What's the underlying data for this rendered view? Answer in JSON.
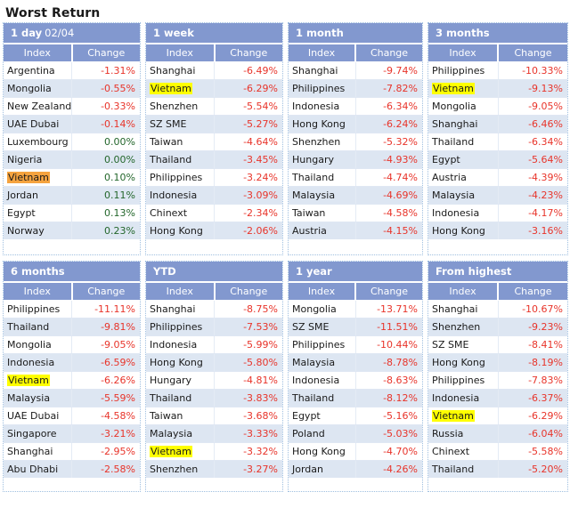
{
  "page": {
    "title": "Worst Return"
  },
  "colors": {
    "header_bg": "#8298cf",
    "negative": "#e8342a",
    "positive": "#23662b",
    "row_alt": "#dde6f2",
    "highlight_yellow": "#ffff00",
    "highlight_orange": "#f5a33f"
  },
  "columns": {
    "index": "Index",
    "change": "Change"
  },
  "tables": [
    {
      "title": "1 day",
      "subtitle": "02/04",
      "rows": [
        {
          "index": "Argentina",
          "change": "-1.31%",
          "sign": "neg",
          "highlight": "none"
        },
        {
          "index": "Mongolia",
          "change": "-0.55%",
          "sign": "neg",
          "highlight": "none"
        },
        {
          "index": "New Zealand",
          "change": "-0.33%",
          "sign": "neg",
          "highlight": "none"
        },
        {
          "index": "UAE Dubai",
          "change": "-0.14%",
          "sign": "neg",
          "highlight": "none"
        },
        {
          "index": "Luxembourg",
          "change": "0.00%",
          "sign": "pos",
          "highlight": "none"
        },
        {
          "index": "Nigeria",
          "change": "0.00%",
          "sign": "pos",
          "highlight": "none"
        },
        {
          "index": "Vietnam",
          "change": "0.10%",
          "sign": "pos",
          "highlight": "orange"
        },
        {
          "index": "Jordan",
          "change": "0.11%",
          "sign": "pos",
          "highlight": "none"
        },
        {
          "index": "Egypt",
          "change": "0.13%",
          "sign": "pos",
          "highlight": "none"
        },
        {
          "index": "Norway",
          "change": "0.23%",
          "sign": "pos",
          "highlight": "none"
        }
      ]
    },
    {
      "title": "1 week",
      "subtitle": "",
      "rows": [
        {
          "index": "Shanghai",
          "change": "-6.49%",
          "sign": "neg",
          "highlight": "none"
        },
        {
          "index": "Vietnam",
          "change": "-6.29%",
          "sign": "neg",
          "highlight": "yellow"
        },
        {
          "index": "Shenzhen",
          "change": "-5.54%",
          "sign": "neg",
          "highlight": "none"
        },
        {
          "index": "SZ SME",
          "change": "-5.27%",
          "sign": "neg",
          "highlight": "none"
        },
        {
          "index": "Taiwan",
          "change": "-4.64%",
          "sign": "neg",
          "highlight": "none"
        },
        {
          "index": "Thailand",
          "change": "-3.45%",
          "sign": "neg",
          "highlight": "none"
        },
        {
          "index": "Philippines",
          "change": "-3.24%",
          "sign": "neg",
          "highlight": "none"
        },
        {
          "index": "Indonesia",
          "change": "-3.09%",
          "sign": "neg",
          "highlight": "none"
        },
        {
          "index": "Chinext",
          "change": "-2.34%",
          "sign": "neg",
          "highlight": "none"
        },
        {
          "index": "Hong Kong",
          "change": "-2.06%",
          "sign": "neg",
          "highlight": "none"
        }
      ]
    },
    {
      "title": "1 month",
      "subtitle": "",
      "rows": [
        {
          "index": "Shanghai",
          "change": "-9.74%",
          "sign": "neg",
          "highlight": "none"
        },
        {
          "index": "Philippines",
          "change": "-7.82%",
          "sign": "neg",
          "highlight": "none"
        },
        {
          "index": "Indonesia",
          "change": "-6.34%",
          "sign": "neg",
          "highlight": "none"
        },
        {
          "index": "Hong Kong",
          "change": "-6.24%",
          "sign": "neg",
          "highlight": "none"
        },
        {
          "index": "Shenzhen",
          "change": "-5.32%",
          "sign": "neg",
          "highlight": "none"
        },
        {
          "index": "Hungary",
          "change": "-4.93%",
          "sign": "neg",
          "highlight": "none"
        },
        {
          "index": "Thailand",
          "change": "-4.74%",
          "sign": "neg",
          "highlight": "none"
        },
        {
          "index": "Malaysia",
          "change": "-4.69%",
          "sign": "neg",
          "highlight": "none"
        },
        {
          "index": "Taiwan",
          "change": "-4.58%",
          "sign": "neg",
          "highlight": "none"
        },
        {
          "index": "Austria",
          "change": "-4.15%",
          "sign": "neg",
          "highlight": "none"
        }
      ]
    },
    {
      "title": "3 months",
      "subtitle": "",
      "rows": [
        {
          "index": "Philippines",
          "change": "-10.33%",
          "sign": "neg",
          "highlight": "none"
        },
        {
          "index": "Vietnam",
          "change": "-9.13%",
          "sign": "neg",
          "highlight": "yellow"
        },
        {
          "index": "Mongolia",
          "change": "-9.05%",
          "sign": "neg",
          "highlight": "none"
        },
        {
          "index": "Shanghai",
          "change": "-6.46%",
          "sign": "neg",
          "highlight": "none"
        },
        {
          "index": "Thailand",
          "change": "-6.34%",
          "sign": "neg",
          "highlight": "none"
        },
        {
          "index": "Egypt",
          "change": "-5.64%",
          "sign": "neg",
          "highlight": "none"
        },
        {
          "index": "Austria",
          "change": "-4.39%",
          "sign": "neg",
          "highlight": "none"
        },
        {
          "index": "Malaysia",
          "change": "-4.23%",
          "sign": "neg",
          "highlight": "none"
        },
        {
          "index": "Indonesia",
          "change": "-4.17%",
          "sign": "neg",
          "highlight": "none"
        },
        {
          "index": "Hong Kong",
          "change": "-3.16%",
          "sign": "neg",
          "highlight": "none"
        }
      ]
    },
    {
      "title": "6 months",
      "subtitle": "",
      "rows": [
        {
          "index": "Philippines",
          "change": "-11.11%",
          "sign": "neg",
          "highlight": "none"
        },
        {
          "index": "Thailand",
          "change": "-9.81%",
          "sign": "neg",
          "highlight": "none"
        },
        {
          "index": "Mongolia",
          "change": "-9.05%",
          "sign": "neg",
          "highlight": "none"
        },
        {
          "index": "Indonesia",
          "change": "-6.59%",
          "sign": "neg",
          "highlight": "none"
        },
        {
          "index": "Vietnam",
          "change": "-6.26%",
          "sign": "neg",
          "highlight": "yellow"
        },
        {
          "index": "Malaysia",
          "change": "-5.59%",
          "sign": "neg",
          "highlight": "none"
        },
        {
          "index": "UAE Dubai",
          "change": "-4.58%",
          "sign": "neg",
          "highlight": "none"
        },
        {
          "index": "Singapore",
          "change": "-3.21%",
          "sign": "neg",
          "highlight": "none"
        },
        {
          "index": "Shanghai",
          "change": "-2.95%",
          "sign": "neg",
          "highlight": "none"
        },
        {
          "index": "Abu Dhabi",
          "change": "-2.58%",
          "sign": "neg",
          "highlight": "none"
        }
      ]
    },
    {
      "title": "YTD",
      "subtitle": "",
      "rows": [
        {
          "index": "Shanghai",
          "change": "-8.75%",
          "sign": "neg",
          "highlight": "none"
        },
        {
          "index": "Philippines",
          "change": "-7.53%",
          "sign": "neg",
          "highlight": "none"
        },
        {
          "index": "Indonesia",
          "change": "-5.99%",
          "sign": "neg",
          "highlight": "none"
        },
        {
          "index": "Hong Kong",
          "change": "-5.80%",
          "sign": "neg",
          "highlight": "none"
        },
        {
          "index": "Hungary",
          "change": "-4.81%",
          "sign": "neg",
          "highlight": "none"
        },
        {
          "index": "Thailand",
          "change": "-3.83%",
          "sign": "neg",
          "highlight": "none"
        },
        {
          "index": "Taiwan",
          "change": "-3.68%",
          "sign": "neg",
          "highlight": "none"
        },
        {
          "index": "Malaysia",
          "change": "-3.33%",
          "sign": "neg",
          "highlight": "none"
        },
        {
          "index": "Vietnam",
          "change": "-3.32%",
          "sign": "neg",
          "highlight": "yellow"
        },
        {
          "index": "Shenzhen",
          "change": "-3.27%",
          "sign": "neg",
          "highlight": "none"
        }
      ]
    },
    {
      "title": "1 year",
      "subtitle": "",
      "rows": [
        {
          "index": "Mongolia",
          "change": "-13.71%",
          "sign": "neg",
          "highlight": "none"
        },
        {
          "index": "SZ SME",
          "change": "-11.51%",
          "sign": "neg",
          "highlight": "none"
        },
        {
          "index": "Philippines",
          "change": "-10.44%",
          "sign": "neg",
          "highlight": "none"
        },
        {
          "index": "Malaysia",
          "change": "-8.78%",
          "sign": "neg",
          "highlight": "none"
        },
        {
          "index": "Indonesia",
          "change": "-8.63%",
          "sign": "neg",
          "highlight": "none"
        },
        {
          "index": "Thailand",
          "change": "-8.12%",
          "sign": "neg",
          "highlight": "none"
        },
        {
          "index": "Egypt",
          "change": "-5.16%",
          "sign": "neg",
          "highlight": "none"
        },
        {
          "index": "Poland",
          "change": "-5.03%",
          "sign": "neg",
          "highlight": "none"
        },
        {
          "index": "Hong Kong",
          "change": "-4.70%",
          "sign": "neg",
          "highlight": "none"
        },
        {
          "index": "Jordan",
          "change": "-4.26%",
          "sign": "neg",
          "highlight": "none"
        }
      ]
    },
    {
      "title": "From highest",
      "subtitle": "",
      "rows": [
        {
          "index": "Shanghai",
          "change": "-10.67%",
          "sign": "neg",
          "highlight": "none"
        },
        {
          "index": "Shenzhen",
          "change": "-9.23%",
          "sign": "neg",
          "highlight": "none"
        },
        {
          "index": "SZ SME",
          "change": "-8.41%",
          "sign": "neg",
          "highlight": "none"
        },
        {
          "index": "Hong Kong",
          "change": "-8.19%",
          "sign": "neg",
          "highlight": "none"
        },
        {
          "index": "Philippines",
          "change": "-7.83%",
          "sign": "neg",
          "highlight": "none"
        },
        {
          "index": "Indonesia",
          "change": "-6.37%",
          "sign": "neg",
          "highlight": "none"
        },
        {
          "index": "Vietnam",
          "change": "-6.29%",
          "sign": "neg",
          "highlight": "yellow"
        },
        {
          "index": "Russia",
          "change": "-6.04%",
          "sign": "neg",
          "highlight": "none"
        },
        {
          "index": "Chinext",
          "change": "-5.58%",
          "sign": "neg",
          "highlight": "none"
        },
        {
          "index": "Thailand",
          "change": "-5.20%",
          "sign": "neg",
          "highlight": "none"
        }
      ]
    }
  ]
}
